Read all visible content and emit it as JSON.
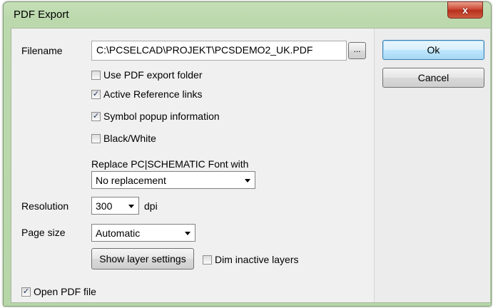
{
  "window": {
    "title": "PDF Export",
    "close_label": "x"
  },
  "filename": {
    "label": "Filename",
    "value": "C:\\PCSELCAD\\PROJEKT\\PCSDEMO2_UK.PDF",
    "browse_label": "..."
  },
  "options": [
    {
      "label": "Use PDF export folder",
      "checked": false,
      "check_mark": ""
    },
    {
      "label": "Active Reference links",
      "checked": true,
      "check_mark": "✓"
    },
    {
      "label": "Symbol popup information",
      "checked": true,
      "check_mark": "✓"
    },
    {
      "label": "Black/White",
      "checked": false,
      "check_mark": ""
    }
  ],
  "font_replace": {
    "label": "Replace PC|SCHEMATIC Font with",
    "value": "No replacement"
  },
  "resolution": {
    "label": "Resolution",
    "value": "300",
    "unit": "dpi"
  },
  "page_size": {
    "label": "Page size",
    "value": "Automatic"
  },
  "layers": {
    "button_label": "Show layer settings",
    "dim_label": "Dim inactive layers",
    "dim_checked": false,
    "dim_mark": ""
  },
  "open_pdf": {
    "label": "Open PDF file",
    "checked": true,
    "check_mark": "✓"
  },
  "actions": {
    "ok_label": "Ok",
    "cancel_label": "Cancel"
  }
}
